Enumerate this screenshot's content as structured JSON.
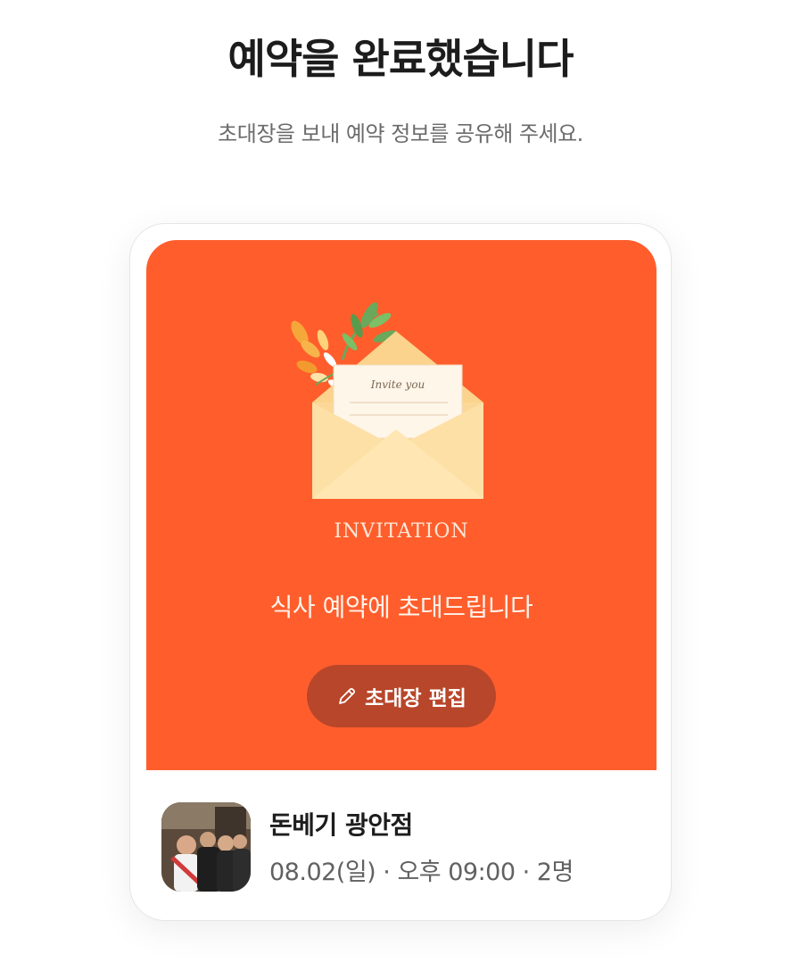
{
  "header": {
    "title": "예약을 완료했습니다",
    "subtitle": "초대장을 보내 예약 정보를 공유해 주세요."
  },
  "invitation_card": {
    "background_color": "#ff5e2c",
    "envelope_note_text": "Invite you",
    "invitation_word": "INVITATION",
    "message": "식사 예약에 초대드립니다",
    "edit_button": {
      "label": "초대장 편집",
      "icon": "pencil-icon",
      "color": "#b8462a"
    }
  },
  "reservation": {
    "restaurant_name": "돈베기 광안점",
    "detail": "08.02(일) · 오후 09:00 · 2명"
  }
}
